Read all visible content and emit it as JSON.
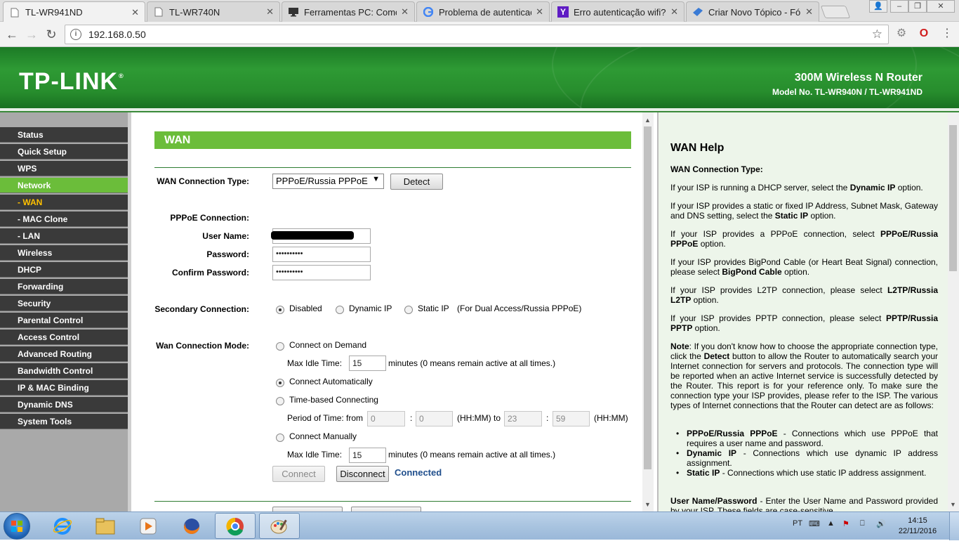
{
  "browser": {
    "tabs": [
      {
        "title": "TL-WR941ND",
        "icon": "page-icon",
        "active": true
      },
      {
        "title": "TL-WR740N",
        "icon": "page-icon"
      },
      {
        "title": "Ferramentas PC: Como li",
        "icon": "monitor-icon"
      },
      {
        "title": "Problema de autenticaçã",
        "icon": "google-icon"
      },
      {
        "title": "Erro autenticação wifi? | Y",
        "icon": "yahoo-icon"
      },
      {
        "title": "Criar Novo Tópico - Fóru",
        "icon": "forum-icon"
      }
    ],
    "close_glyph": "✕",
    "url": "192.168.0.50"
  },
  "header": {
    "logo": "TP-LINK",
    "logo_reg": "®",
    "product": "300M Wireless N Router",
    "model": "Model No. TL-WR940N / TL-WR941ND"
  },
  "menu": [
    {
      "label": "Status"
    },
    {
      "label": "Quick Setup"
    },
    {
      "label": "WPS"
    },
    {
      "label": "Network",
      "active": true
    },
    {
      "label": "- WAN",
      "sub": true,
      "current": true
    },
    {
      "label": "- MAC Clone",
      "sub": true
    },
    {
      "label": "- LAN",
      "sub": true
    },
    {
      "label": "Wireless"
    },
    {
      "label": "DHCP"
    },
    {
      "label": "Forwarding"
    },
    {
      "label": "Security"
    },
    {
      "label": "Parental Control"
    },
    {
      "label": "Access Control"
    },
    {
      "label": "Advanced Routing"
    },
    {
      "label": "Bandwidth Control"
    },
    {
      "label": "IP & MAC Binding"
    },
    {
      "label": "Dynamic DNS"
    },
    {
      "label": "System Tools"
    }
  ],
  "wan": {
    "title": "WAN",
    "connection_type_label": "WAN Connection Type:",
    "connection_type_value": "PPPoE/Russia PPPoE",
    "detect_button": "Detect",
    "pppoe_heading": "PPPoE Connection:",
    "username_label": "User Name:",
    "username_value": "",
    "password_label": "Password:",
    "password_value": "••••••••••",
    "confirm_label": "Confirm Password:",
    "confirm_value": "••••••••••",
    "secondary_label": "Secondary Connection:",
    "secondary_options": [
      "Disabled",
      "Dynamic IP",
      "Static IP"
    ],
    "secondary_selected": "Disabled",
    "secondary_note": "(For Dual Access/Russia PPPoE)",
    "mode_label": "Wan Connection Mode:",
    "mode_on_demand": "Connect on Demand",
    "max_idle_label": "Max Idle Time:",
    "max_idle_value_1": "15",
    "minutes_note": "minutes (0 means remain active at all times.)",
    "mode_auto": "Connect Automatically",
    "mode_time": "Time-based Connecting",
    "period_label": "Period of Time: from",
    "from_hh": "0",
    "from_mm": "0",
    "hhmm_to": "(HH:MM) to",
    "to_hh": "23",
    "to_mm": "59",
    "hhmm": "(HH:MM)",
    "colon": ":",
    "mode_manual": "Connect Manually",
    "max_idle_value_2": "15",
    "mode_selected": "Connect Automatically",
    "connect_button": "Connect",
    "disconnect_button": "Disconnect",
    "status": "Connected"
  },
  "help": {
    "title": "WAN Help",
    "subtitle": "WAN Connection Type:",
    "p1a": "If your ISP is running a DHCP server, select the ",
    "p1b": "Dynamic IP",
    "p1c": " option.",
    "p2a": "If your ISP provides a static or fixed IP Address, Subnet Mask, Gateway and DNS setting, select the ",
    "p2b": "Static IP",
    "p2c": " option.",
    "p3a": "If your ISP provides a PPPoE connection, select ",
    "p3b": "PPPoE/Russia PPPoE",
    "p3c": " option.",
    "p4a": "If your ISP provides BigPond Cable (or Heart Beat Signal) connection, please select ",
    "p4b": "BigPond Cable",
    "p4c": " option.",
    "p5a": "If your ISP provides L2TP connection, please select ",
    "p5b": "L2TP/Russia L2TP",
    "p5c": " option.",
    "p6a": "If your ISP provides PPTP connection, please select ",
    "p6b": "PPTP/Russia PPTP",
    "p6c": " option.",
    "note_b": "Note",
    "note_a": ": If you don't know how to choose the appropriate connection type, click the ",
    "note_detect": "Detect",
    "note_c": " button to allow the Router to automatically search your Internet connection for servers and protocols. The connection type will be reported when an active Internet service is successfully detected by the Router. This report is for your reference only. To make sure the connection type your ISP provides, please refer to the ISP. The various types of Internet connections that the Router can detect are as follows:",
    "li1b": "PPPoE/Russia PPPoE",
    "li1a": " - Connections which use PPPoE that requires a user name and password.",
    "li2b": "Dynamic IP",
    "li2a": " - Connections which use dynamic IP address assignment.",
    "li3b": "Static IP",
    "li3a": " - Connections which use static IP address assignment.",
    "last_b": "User Name/Password",
    "last_a": " - Enter the User Name and Password provided by your ISP. These fields are case-sensitive."
  },
  "taskbar": {
    "language": "PT",
    "time": "14:15",
    "date": "22/11/2016"
  }
}
